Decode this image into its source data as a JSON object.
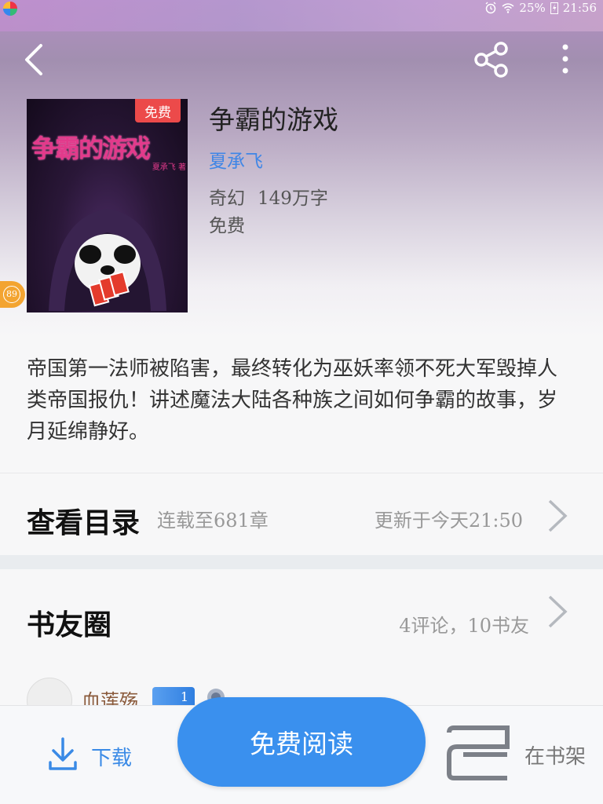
{
  "status_bar": {
    "battery": "25%",
    "time": "21:56"
  },
  "header": {
    "back_icon": "chevron-left-icon",
    "share_icon": "share-icon",
    "more_icon": "more-vertical-icon"
  },
  "book": {
    "cover_title": "争霸的游戏",
    "cover_author": "夏承飞 著",
    "free_badge": "免费",
    "title": "争霸的游戏",
    "author": "夏承飞",
    "genre": "奇幻",
    "word_count": "149万字",
    "price": "免费",
    "level_badge": "89"
  },
  "intro": {
    "text": "帝国第一法师被陷害，最终转化为巫妖率领不死大军毁掉人类帝国报仇！讲述魔法大陆各种族之间如何争霸的故事，岁月延绵静好。"
  },
  "catalog": {
    "title": "查看目录",
    "serial_status": "连载至681章",
    "updated": "更新于今天21:50"
  },
  "book_circle": {
    "title": "书友圈",
    "stats": "4评论，10书友",
    "first_reviewer": {
      "name": "血莲殇",
      "level": "1"
    }
  },
  "bottom_bar": {
    "download_label": "下载",
    "read_label": "免费阅读",
    "shelf_label": "在书架"
  },
  "colors": {
    "accent": "#3a90ee",
    "author_link": "#3f86e6",
    "badge_red": "#ec4a4a",
    "level_orange": "#f3a431"
  }
}
